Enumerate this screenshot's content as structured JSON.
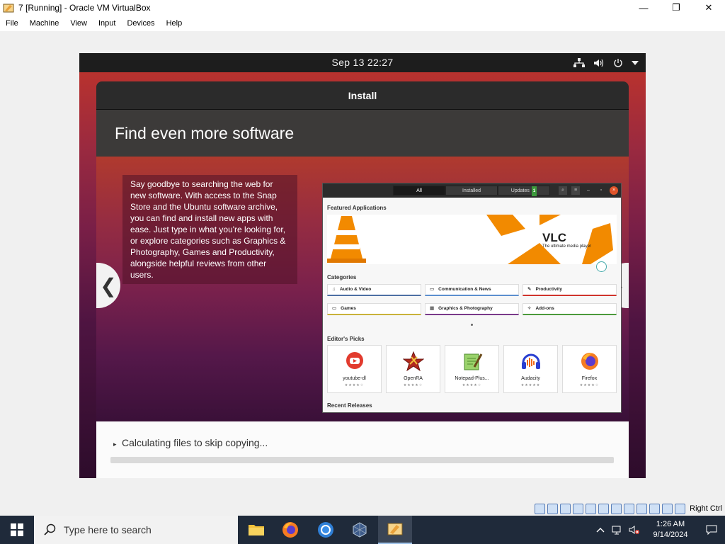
{
  "window": {
    "title": "7 [Running] - Oracle VM VirtualBox",
    "minimize": "—",
    "maximize": "❐",
    "close": "✕"
  },
  "menu": [
    "File",
    "Machine",
    "View",
    "Input",
    "Devices",
    "Help"
  ],
  "guest": {
    "topbar": {
      "clock": "Sep 13  22:27"
    },
    "dialog": {
      "title": "Install",
      "slide_title": "Find even more software",
      "description": "Say goodbye to searching the web for new software. With access to the Snap Store and the Ubuntu software archive, you can find and install new apps with ease. Just type in what you're looking for, or explore categories such as Graphics & Photography, Games and Productivity, alongside helpful reviews from other users.",
      "prev": "❮",
      "next": "❯",
      "screenshot": {
        "tabs": [
          "All",
          "Installed",
          "Updates"
        ],
        "updates_badge": "1",
        "featured_heading": "Featured Applications",
        "banner_name": "VLC",
        "banner_sub": "The ultimate media player",
        "categories_heading": "Categories",
        "categories": [
          {
            "icon": "♫",
            "label": "Audio & Video",
            "color": "#4d6fa3"
          },
          {
            "icon": "▭",
            "label": "Communication & News",
            "color": "#5b8fcf"
          },
          {
            "icon": "✎",
            "label": "Productivity",
            "color": "#d0342c"
          },
          {
            "icon": "▭",
            "label": "Games",
            "color": "#c9b23a"
          },
          {
            "icon": "▦",
            "label": "Graphics & Photography",
            "color": "#7a3a8a"
          },
          {
            "icon": "✧",
            "label": "Add-ons",
            "color": "#4c9a3c"
          }
        ],
        "picks_heading": "Editor's Picks",
        "picks": [
          {
            "name": "youtube-dl",
            "stars": "★★★★☆"
          },
          {
            "name": "OpenRA",
            "stars": "★★★★☆"
          },
          {
            "name": "Notepad-Plus...",
            "stars": "★★★★☆"
          },
          {
            "name": "Audacity",
            "stars": "★★★★★"
          },
          {
            "name": "Firefox",
            "stars": "★★★★☆"
          }
        ],
        "recent_heading": "Recent Releases"
      },
      "progress": {
        "arrow": "▸",
        "message": "Calculating files to skip copying...",
        "value": 0
      }
    }
  },
  "statusbar": {
    "host_key": "Right Ctrl"
  },
  "taskbar": {
    "search_placeholder": "Type here to search",
    "time": "1:26 AM",
    "date": "9/14/2024"
  },
  "colors": {
    "accent": "#e95420",
    "taskbar": "#1f2a3a",
    "vlc_orange": "#f28a00"
  }
}
